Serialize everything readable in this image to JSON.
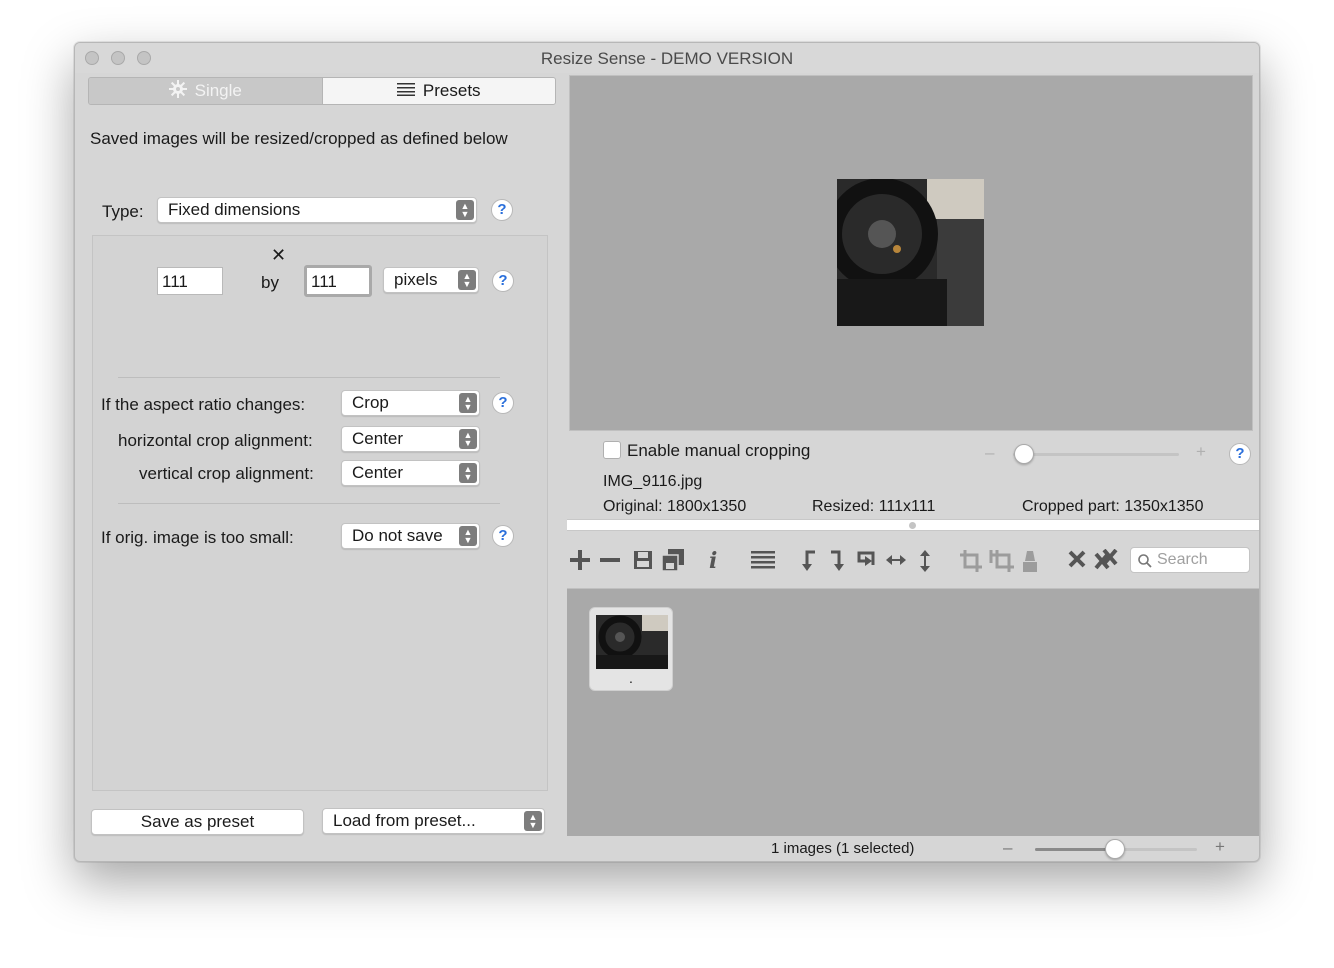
{
  "window": {
    "title": "Resize Sense - DEMO VERSION"
  },
  "tabs": [
    {
      "label": "Single",
      "icon": "gear-icon"
    },
    {
      "label": "Presets",
      "icon": "list-icon"
    }
  ],
  "left": {
    "description": "Saved images will be resized/cropped as defined below",
    "type_label": "Type:",
    "type_value": "Fixed dimensions",
    "swap_symbol": "✕",
    "width_value": "111",
    "by_label": "by",
    "height_value": "111",
    "unit_value": "pixels",
    "aspect_label": "If the aspect ratio changes:",
    "aspect_value": "Crop",
    "hcrop_label": "horizontal crop alignment:",
    "hcrop_value": "Center",
    "vcrop_label": "vertical crop alignment:",
    "vcrop_value": "Center",
    "small_label": "If orig. image is too small:",
    "small_value": "Do not save",
    "save_preset_label": "Save as preset",
    "load_preset_label": "Load from preset..."
  },
  "right": {
    "manual_crop_label": "Enable manual cropping",
    "manual_crop_checked": false,
    "zoom_minus": "–",
    "zoom_plus": "+",
    "filename": "IMG_9116.jpg",
    "original": "Original: 1800x1350",
    "resized": "Resized: 111x111",
    "cropped": "Cropped part: 1350x1350",
    "search_placeholder": "Search",
    "thumbnail_caption": ".",
    "status": "1 images (1 selected)",
    "thumb_zoom_minus": "–",
    "thumb_zoom_plus": "+",
    "crop_zoom_level": 0.05,
    "thumb_zoom_level": 0.5
  },
  "help_symbol": "?",
  "toolbar_icons": [
    "add-icon",
    "remove-icon",
    "save-icon",
    "save-all-icon",
    "info-icon",
    "list-icon",
    "rotate-left-icon",
    "rotate-right-icon",
    "rotate-180-icon",
    "flip-horizontal-icon",
    "flip-vertical-icon",
    "crop-icon",
    "crop-all-icon",
    "clear-icon",
    "delete-icon",
    "delete-all-icon"
  ]
}
